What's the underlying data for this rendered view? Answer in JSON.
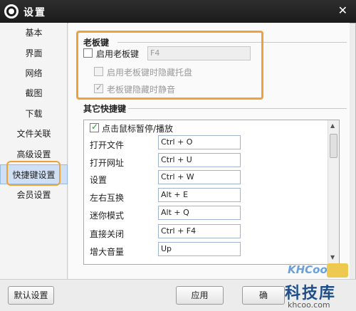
{
  "window": {
    "title": "设置"
  },
  "sidebar": {
    "items": [
      {
        "label": "基本",
        "active": false
      },
      {
        "label": "界面",
        "active": false
      },
      {
        "label": "网络",
        "active": false
      },
      {
        "label": "截图",
        "active": false
      },
      {
        "label": "下载",
        "active": false
      },
      {
        "label": "文件关联",
        "active": false
      },
      {
        "label": "高级设置",
        "active": false
      },
      {
        "label": "快捷键设置",
        "active": true
      },
      {
        "label": "会员设置",
        "active": false
      }
    ]
  },
  "boss_key": {
    "section_title": "老板键",
    "enable_label": "启用老板键",
    "enable_checked": false,
    "key_value": "F4",
    "hide_tray_label": "启用老板键时隐藏托盘",
    "hide_tray_checked": false,
    "mute_label": "老板键隐藏时静音",
    "mute_checked": true
  },
  "other_shortcuts": {
    "section_title": "其它快捷键",
    "pause_play_label": "点击鼠标暂停/播放",
    "pause_play_checked": true,
    "rows": [
      {
        "label": "打开文件",
        "key": "Ctrl + O"
      },
      {
        "label": "打开网址",
        "key": "Ctrl + U"
      },
      {
        "label": "设置",
        "key": "Ctrl + W"
      },
      {
        "label": "左右互换",
        "key": "Alt + E"
      },
      {
        "label": "迷你模式",
        "key": "Alt + Q"
      },
      {
        "label": "直接关闭",
        "key": "Ctrl + F4"
      },
      {
        "label": "增大音量",
        "key": "Up"
      }
    ]
  },
  "footer": {
    "default_button": "默认设置",
    "apply_button": "应用",
    "ok_button": "确"
  },
  "watermark": {
    "brand": "KHCoo",
    "name": "科技库",
    "url": "khcoo.com"
  },
  "colors": {
    "highlight": "#f0a23a",
    "titlebar": "#1b1b1b",
    "active_nav": "#cfe0f5"
  }
}
